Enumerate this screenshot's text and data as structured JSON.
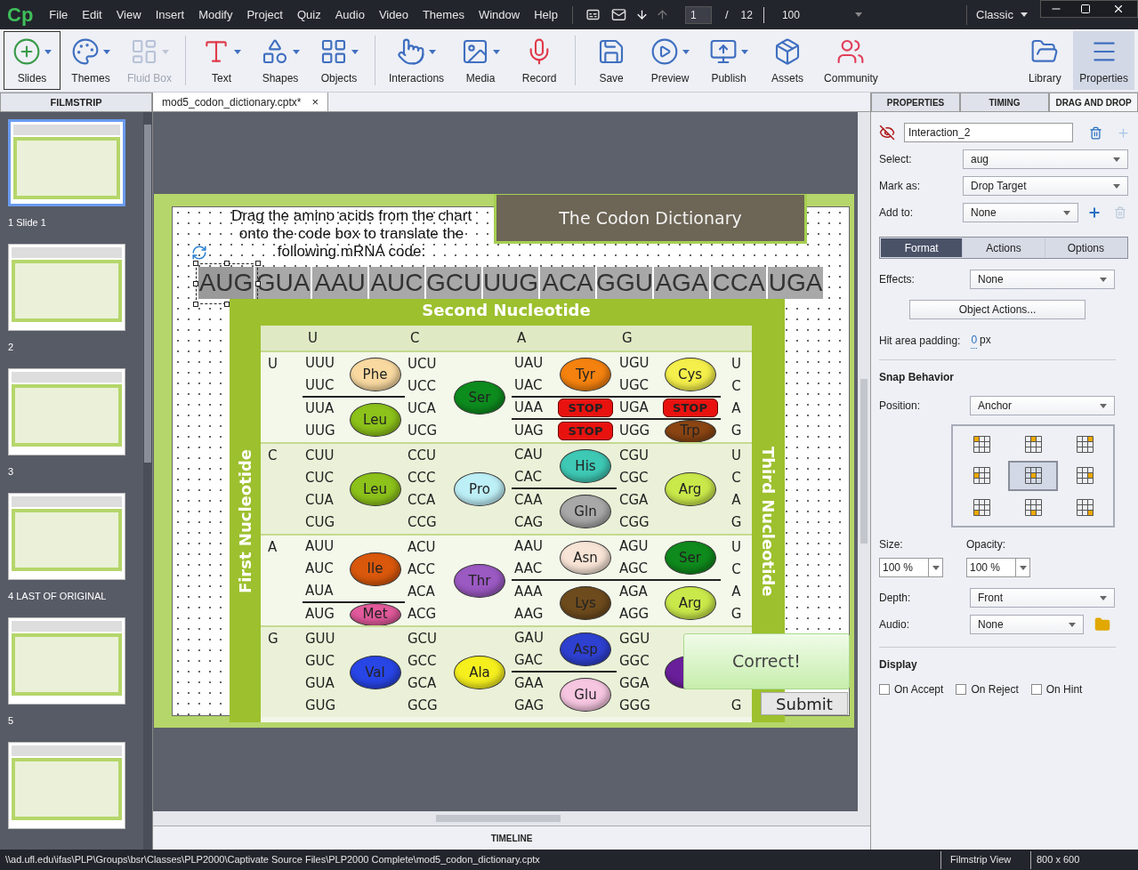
{
  "menubar": {
    "logo": "Cp",
    "menus": [
      "File",
      "Edit",
      "View",
      "Insert",
      "Modify",
      "Project",
      "Quiz",
      "Audio",
      "Video",
      "Themes",
      "Window",
      "Help"
    ],
    "page_current": "1",
    "page_separator": "/",
    "page_total": "12",
    "zoom": "100",
    "workspace": "Classic"
  },
  "toolbar": {
    "groups": [
      {
        "items": [
          {
            "label": "Slides",
            "has_menu": true,
            "disabled": false,
            "outlined": true,
            "selected": false
          },
          {
            "label": "Themes",
            "has_menu": true,
            "disabled": false,
            "outlined": false,
            "selected": false
          },
          {
            "label": "Fluid Box",
            "has_menu": true,
            "disabled": true,
            "outlined": false,
            "selected": false
          }
        ]
      },
      {
        "items": [
          {
            "label": "Text",
            "has_menu": true,
            "disabled": false,
            "outlined": false,
            "selected": false
          },
          {
            "label": "Shapes",
            "has_menu": true,
            "disabled": false,
            "outlined": false,
            "selected": false
          },
          {
            "label": "Objects",
            "has_menu": true,
            "disabled": false,
            "outlined": false,
            "selected": false
          }
        ]
      },
      {
        "items": [
          {
            "label": "Interactions",
            "has_menu": true,
            "disabled": false,
            "outlined": false,
            "selected": false
          },
          {
            "label": "Media",
            "has_menu": true,
            "disabled": false,
            "outlined": false,
            "selected": false
          },
          {
            "label": "Record",
            "has_menu": false,
            "disabled": false,
            "outlined": false,
            "selected": false
          }
        ]
      },
      {
        "items": [
          {
            "label": "Save",
            "has_menu": false,
            "disabled": false,
            "outlined": false,
            "selected": false
          },
          {
            "label": "Preview",
            "has_menu": true,
            "disabled": false,
            "outlined": false,
            "selected": false
          },
          {
            "label": "Publish",
            "has_menu": true,
            "disabled": false,
            "outlined": false,
            "selected": false
          },
          {
            "label": "Assets",
            "has_menu": false,
            "disabled": false,
            "outlined": false,
            "selected": false
          },
          {
            "label": "Community",
            "has_menu": false,
            "disabled": false,
            "outlined": false,
            "selected": false
          }
        ]
      }
    ],
    "right_items": [
      {
        "label": "Library",
        "has_menu": false,
        "disabled": false,
        "outlined": false,
        "selected": false
      },
      {
        "label": "Properties",
        "has_menu": false,
        "disabled": false,
        "outlined": false,
        "selected": true
      }
    ]
  },
  "filmstrip": {
    "title": "FILMSTRIP",
    "slides": [
      {
        "label": "1 Slide 1",
        "selected": true
      },
      {
        "label": "2",
        "selected": false
      },
      {
        "label": "3",
        "selected": false
      },
      {
        "label": "4 LAST OF ORIGINAL",
        "selected": false
      },
      {
        "label": "5",
        "selected": false
      },
      {
        "selected": false
      }
    ]
  },
  "document_tab": {
    "title": "mod5_codon_dictionary.cptx*",
    "close": "×"
  },
  "slide": {
    "title": "The Codon Dictionary",
    "instruction": "Drag the amino acids from the chart\nonto the code box to translate the\nfollowing mRNA code:",
    "codons": [
      {
        "text": "AUG",
        "selected": true
      },
      {
        "text": "GUA",
        "selected": false
      },
      {
        "text": "AAU",
        "selected": false
      },
      {
        "text": "AUC",
        "selected": false
      },
      {
        "text": "GCU",
        "selected": false
      },
      {
        "text": "UUG",
        "selected": false
      },
      {
        "text": "ACA",
        "selected": false
      },
      {
        "text": "GGU",
        "selected": false
      },
      {
        "text": "AGA",
        "selected": false
      },
      {
        "text": "CCA",
        "selected": false
      },
      {
        "text": "UGA",
        "selected": false
      }
    ],
    "table": {
      "header": "Second Nucleotide",
      "left_label": "First Nucleotide",
      "right_label": "Third Nucleotide",
      "columns": [
        "U",
        "C",
        "A",
        "G"
      ],
      "rows": [
        {
          "base": "U",
          "third": [
            "U",
            "C",
            "A",
            "G"
          ],
          "cells": [
            {
              "groups": [
                {
                  "codons": [
                    "UUU",
                    "UUC"
                  ],
                  "kind": "amino",
                  "amino": "Phe",
                  "color": "#f9d9a0"
                },
                {
                  "codons": [
                    "UUA",
                    "UUG"
                  ],
                  "kind": "amino",
                  "amino": "Leu",
                  "color": "#8cc21a"
                }
              ]
            },
            {
              "groups": [
                {
                  "codons": [
                    "UCU",
                    "UCC",
                    "UCA",
                    "UCG"
                  ],
                  "kind": "amino",
                  "amino": "Ser",
                  "color": "#0d8c1e"
                }
              ]
            },
            {
              "groups": [
                {
                  "codons": [
                    "UAU",
                    "UAC"
                  ],
                  "kind": "amino",
                  "amino": "Tyr",
                  "color": "#f5820f"
                },
                {
                  "codons": [
                    "UAA"
                  ],
                  "kind": "stop",
                  "amino": "STOP",
                  "color": "#e8120f"
                },
                {
                  "codons": [
                    "UAG"
                  ],
                  "kind": "stop",
                  "amino": "STOP",
                  "color": "#e8120f"
                }
              ]
            },
            {
              "groups": [
                {
                  "codons": [
                    "UGU",
                    "UGC"
                  ],
                  "kind": "amino",
                  "amino": "Cys",
                  "color": "#f4ef4a"
                },
                {
                  "codons": [
                    "UGA"
                  ],
                  "kind": "stop",
                  "amino": "STOP",
                  "color": "#e8120f"
                },
                {
                  "codons": [
                    "UGG"
                  ],
                  "kind": "amino",
                  "amino": "Trp",
                  "color": "#8b4513"
                }
              ]
            }
          ]
        },
        {
          "base": "C",
          "third": [
            "U",
            "C",
            "A",
            "G"
          ],
          "cells": [
            {
              "groups": [
                {
                  "codons": [
                    "CUU",
                    "CUC",
                    "CUA",
                    "CUG"
                  ],
                  "kind": "amino",
                  "amino": "Leu",
                  "color": "#8cc21a"
                }
              ]
            },
            {
              "groups": [
                {
                  "codons": [
                    "CCU",
                    "CCC",
                    "CCA",
                    "CCG"
                  ],
                  "kind": "amino",
                  "amino": "Pro",
                  "color": "#bdeff7"
                }
              ]
            },
            {
              "groups": [
                {
                  "codons": [
                    "CAU",
                    "CAC"
                  ],
                  "kind": "amino",
                  "amino": "His",
                  "color": "#3ec9b5"
                },
                {
                  "codons": [
                    "CAA",
                    "CAG"
                  ],
                  "kind": "amino",
                  "amino": "Gln",
                  "color": "#a8a8a8"
                }
              ]
            },
            {
              "groups": [
                {
                  "codons": [
                    "CGU",
                    "CGC",
                    "CGA",
                    "CGG"
                  ],
                  "kind": "amino",
                  "amino": "Arg",
                  "color": "#c9e84a"
                }
              ]
            }
          ]
        },
        {
          "base": "A",
          "third": [
            "U",
            "C",
            "A",
            "G"
          ],
          "cells": [
            {
              "groups": [
                {
                  "codons": [
                    "AUU",
                    "AUC",
                    "AUA"
                  ],
                  "kind": "amino",
                  "amino": "Ile",
                  "color": "#d9580c"
                },
                {
                  "codons": [
                    "AUG"
                  ],
                  "kind": "amino",
                  "amino": "Met",
                  "color": "#e35a9c"
                }
              ]
            },
            {
              "groups": [
                {
                  "codons": [
                    "ACU",
                    "ACC",
                    "ACA",
                    "ACG"
                  ],
                  "kind": "amino",
                  "amino": "Thr",
                  "color": "#9b59c2"
                }
              ]
            },
            {
              "groups": [
                {
                  "codons": [
                    "AAU",
                    "AAC"
                  ],
                  "kind": "amino",
                  "amino": "Asn",
                  "color": "#f8e4d6"
                },
                {
                  "codons": [
                    "AAA",
                    "AAG"
                  ],
                  "kind": "amino",
                  "amino": "Lys",
                  "color": "#6e4b1d"
                }
              ]
            },
            {
              "groups": [
                {
                  "codons": [
                    "AGU",
                    "AGC"
                  ],
                  "kind": "amino",
                  "amino": "Ser",
                  "color": "#0f8a1c"
                },
                {
                  "codons": [
                    "AGA",
                    "AGG"
                  ],
                  "kind": "amino",
                  "amino": "Arg",
                  "color": "#c9e84a"
                }
              ]
            }
          ]
        },
        {
          "base": "G",
          "third": [
            "G"
          ],
          "cells": [
            {
              "groups": [
                {
                  "codons": [
                    "GUU",
                    "GUC",
                    "GUA",
                    "GUG"
                  ],
                  "kind": "amino",
                  "amino": "Val",
                  "color": "#2845e6"
                }
              ]
            },
            {
              "groups": [
                {
                  "codons": [
                    "GCU",
                    "GCC",
                    "GCA",
                    "GCG"
                  ],
                  "kind": "amino",
                  "amino": "Ala",
                  "color": "#f5ef1e"
                }
              ]
            },
            {
              "groups": [
                {
                  "codons": [
                    "GAU",
                    "GAC"
                  ],
                  "kind": "amino",
                  "amino": "Asp",
                  "color": "#2e40d0"
                },
                {
                  "codons": [
                    "GAA",
                    "GAG"
                  ],
                  "kind": "amino",
                  "amino": "Glu",
                  "color": "#f6c5e0"
                }
              ]
            },
            {
              "groups": [
                {
                  "codons": [
                    "GGU",
                    "GGC",
                    "GGA",
                    "GGG"
                  ],
                  "kind": "amino",
                  "color": "#6a1f9a"
                }
              ]
            }
          ]
        }
      ]
    },
    "feedback": "Correct!",
    "submit": "Submit"
  },
  "timeline": {
    "title": "TIMELINE"
  },
  "properties_panel": {
    "tabs": [
      {
        "label": "PROPERTIES",
        "selected": false
      },
      {
        "label": "TIMING",
        "selected": false
      },
      {
        "label": "DRAG AND DROP",
        "selected": true
      }
    ],
    "name": "Interaction_2",
    "select": {
      "label": "Select:",
      "value": "aug"
    },
    "mark_as": {
      "label": "Mark as:",
      "value": "Drop Target"
    },
    "add_to": {
      "label": "Add to:",
      "value": "None"
    },
    "subtabs": [
      {
        "label": "Format",
        "selected": true
      },
      {
        "label": "Actions",
        "selected": false
      },
      {
        "label": "Options",
        "selected": false
      }
    ],
    "effects": {
      "label": "Effects:",
      "value": "None"
    },
    "object_actions": "Object Actions...",
    "hit_area": {
      "label": "Hit area padding:",
      "value": "0",
      "unit": "px"
    },
    "snap": {
      "title": "Snap Behavior",
      "position": {
        "label": "Position:",
        "value": "Anchor"
      },
      "anchors": [
        {
          "selected": false
        },
        {
          "selected": false
        },
        {
          "selected": false
        },
        {
          "selected": false
        },
        {
          "selected": true
        },
        {
          "selected": false
        },
        {
          "selected": false
        },
        {
          "selected": false
        },
        {
          "selected": false
        }
      ]
    },
    "size": {
      "label": "Size:",
      "value": "100 %"
    },
    "opacity": {
      "label": "Opacity:",
      "value": "100 %"
    },
    "depth": {
      "label": "Depth:",
      "value": "Front"
    },
    "audio": {
      "label": "Audio:",
      "value": "None"
    },
    "display": {
      "title": "Display",
      "options": [
        {
          "label": "On Accept",
          "checked": false
        },
        {
          "label": "On Reject",
          "checked": false
        },
        {
          "label": "On Hint",
          "checked": false
        }
      ]
    }
  },
  "status_bar": {
    "path": "\\\\ad.ufl.edu\\ifas\\PLP\\Groups\\bsr\\Classes\\PLP2000\\Captivate Source Files\\PLP2000 Complete\\mod5_codon_dictionary.cptx",
    "view": "Filmstrip View",
    "size": "800 x 600"
  }
}
